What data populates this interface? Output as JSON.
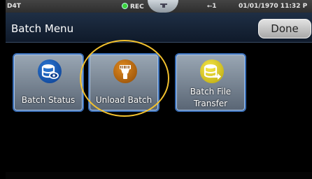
{
  "status_bar": {
    "device": "D4T",
    "rec_label": "REC",
    "usb_label": "1",
    "datetime": "01/01/1970 11:32 P"
  },
  "header": {
    "title": "Batch Menu",
    "done_label": "Done"
  },
  "tiles": [
    {
      "label": "Batch Status",
      "icon": "database-eye-icon"
    },
    {
      "label": "Unload Batch",
      "icon": "barcode-scanner-icon"
    },
    {
      "label_line1": "Batch File",
      "label_line2": "Transfer",
      "icon": "database-transfer-icon"
    }
  ],
  "colors": {
    "highlight": "#f2c12e",
    "tile_border": "#3b6fb7",
    "rec_indicator": "#3cd23c"
  }
}
